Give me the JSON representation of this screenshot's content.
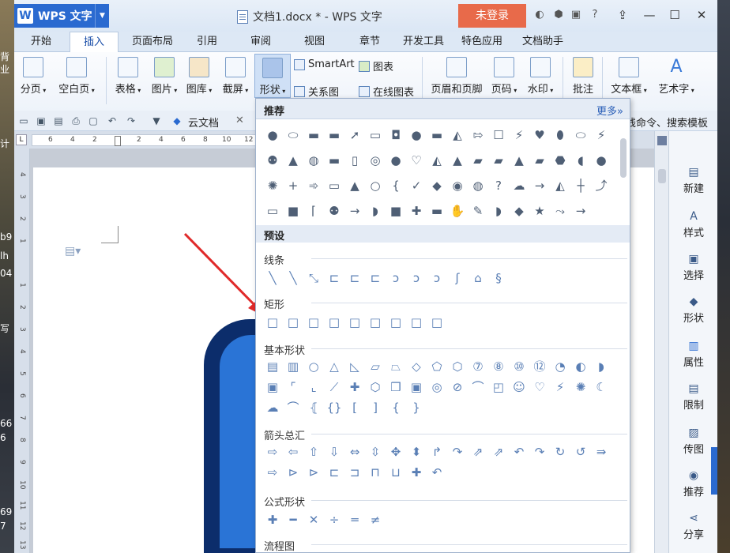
{
  "app": {
    "name": "WPS 文字",
    "title": "文档1.docx * - WPS 文字",
    "login": "未登录"
  },
  "tabs": [
    "开始",
    "插入",
    "页面布局",
    "引用",
    "审阅",
    "视图",
    "章节",
    "开发工具",
    "特色应用",
    "文档助手"
  ],
  "ribbon": {
    "buttons": [
      "分页",
      "空白页",
      "表格",
      "图片",
      "图库",
      "截屏",
      "形状",
      "页眉和页脚",
      "页码",
      "水印",
      "批注",
      "文本框",
      "艺术字"
    ],
    "small": [
      "SmartArt",
      "图表",
      "关系图",
      "在线图表"
    ]
  },
  "qbar": {
    "cloud": "云文档",
    "right_text": "线命令、搜索模板"
  },
  "ruler": {
    "ticks": [
      "6",
      "4",
      "2",
      "",
      "2",
      "4",
      "6",
      "8",
      "10",
      "12"
    ]
  },
  "vruler": [
    "4",
    "3",
    "2",
    "1",
    "",
    "1",
    "2",
    "3",
    "4",
    "5",
    "6",
    "7",
    "8",
    "9",
    "10",
    "11",
    "12",
    "13"
  ],
  "side_panel": [
    "新建",
    "样式",
    "选择",
    "形状",
    "属性",
    "限制",
    "传图",
    "推荐",
    "分享"
  ],
  "desk_fragments": [
    "背",
    "业",
    "计",
    "b9",
    "lh",
    "04",
    "写",
    "66",
    "6",
    "69",
    "7"
  ],
  "panel": {
    "header": "推荐",
    "more": "更多»",
    "preset": "预设",
    "sections": [
      "线条",
      "矩形",
      "基本形状",
      "箭头总汇",
      "公式形状",
      "流程图"
    ],
    "rec_icons": [
      "●",
      "⬭",
      "▬",
      "▬",
      "➚",
      "▭",
      "◘",
      "●",
      "▬",
      "◭",
      "⇰",
      "☐",
      "⚡",
      "♥",
      "⬮",
      "⬭",
      "⚡",
      "⚉",
      "▲",
      "◍",
      "▬",
      "▯",
      "◎",
      "●",
      "♡",
      "◭",
      "▲",
      "▰",
      "▰",
      "▲",
      "▰",
      "⬣",
      "◖",
      "●",
      "✺",
      "+",
      "➾",
      "▭",
      "▲",
      "○",
      "{",
      "✓",
      "◆",
      "◉",
      "◍",
      "?",
      "☁",
      "→",
      "◭",
      "┼",
      "⤴",
      "▭",
      "■",
      "⌈",
      "⚉",
      "→",
      "◗",
      "■",
      "✚",
      "▬",
      "✋",
      "✎",
      "◗",
      "◆",
      "★",
      "⤳",
      "→"
    ],
    "lines_icons": [
      "╲",
      "╲",
      "⤡",
      "⊏",
      "⊏",
      "⊏",
      "ↄ",
      "ↄ",
      "ↄ",
      "ʃ",
      "⌂",
      "§"
    ],
    "rect_icons": [
      "□",
      "□",
      "□",
      "□",
      "□",
      "□",
      "□",
      "□",
      "□"
    ],
    "basic_icons": [
      "▤",
      "▥",
      "○",
      "△",
      "◺",
      "▱",
      "⏢",
      "◇",
      "⬠",
      "⬡",
      "⑦",
      "⑧",
      "⑩",
      "⑫",
      "◔",
      "◐",
      "◗",
      "▣",
      "⌜",
      "⌞",
      "⟋",
      "✚",
      "⬡",
      "❒",
      "▣",
      "◎",
      "⊘",
      "⌒",
      "◰",
      "☺",
      "♡",
      "⚡",
      "✺",
      "☾",
      "☁",
      "⌒",
      "⦃",
      "{}",
      "[",
      "]",
      "{",
      "}"
    ],
    "arrow_icons": [
      "⇨",
      "⇦",
      "⇧",
      "⇩",
      "⇔",
      "⇳",
      "✥",
      "⬍",
      "↱",
      "↷",
      "⇗",
      "⇗",
      "↶",
      "↷",
      "↻",
      "↺",
      "⇛",
      "⇨",
      "⊳",
      "⊳",
      "⊏",
      "⊐",
      "⊓",
      "⊔",
      "✚",
      "↶"
    ],
    "formula_icons": [
      "✚",
      "━",
      "✕",
      "÷",
      "═",
      "≠"
    ]
  }
}
